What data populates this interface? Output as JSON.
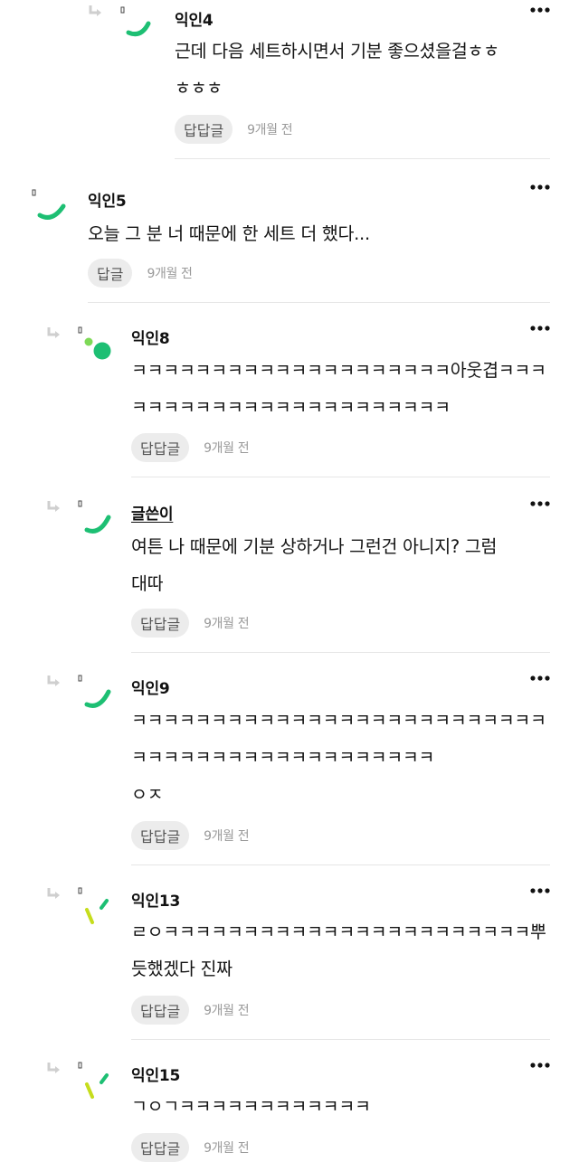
{
  "comments": [
    {
      "author": "익인4",
      "lines": [
        "근데 다음 세트하시면서 기분 좋으셨을걸ㅎㅎ",
        "ㅎㅎㅎ"
      ],
      "reply_label": "답답글",
      "time": "9개월 전"
    },
    {
      "author": "익인5",
      "lines": [
        "오늘 그 분 너 때문에 한 세트 더 했다..."
      ],
      "reply_label": "답글",
      "time": "9개월 전"
    },
    {
      "author": "익인8",
      "lines": [
        "ㅋㅋㅋㅋㅋㅋㅋㅋㅋㅋㅋㅋㅋㅋㅋㅋㅋㅋㅋㅋ아웃겹ㅋㅋㅋ",
        "ㅋㅋㅋㅋㅋㅋㅋㅋㅋㅋㅋㅋㅋㅋㅋㅋㅋㅋㅋㅋ"
      ],
      "reply_label": "답답글",
      "time": "9개월 전"
    },
    {
      "author": "글쓴이",
      "lines": [
        "여튼 나 때문에 기분 상하거나 그런건 아니지? 그럼",
        "대따"
      ],
      "reply_label": "답답글",
      "time": "9개월 전"
    },
    {
      "author": "익인9",
      "lines": [
        "ㅋㅋㅋㅋㅋㅋㅋㅋㅋㅋㅋㅋㅋㅋㅋㅋㅋㅋㅋㅋㅋㅋㅋㅋㅋㅋ",
        "ㅋㅋㅋㅋㅋㅋㅋㅋㅋㅋㅋㅋㅋㅋㅋㅋㅋㅋㅋ",
        "ㅇㅈ"
      ],
      "reply_label": "답답글",
      "time": "9개월 전"
    },
    {
      "author": "익인13",
      "lines": [
        "ㄹㅇㅋㅋㅋㅋㅋㅋㅋㅋㅋㅋㅋㅋㅋㅋㅋㅋㅋㅋㅋㅋㅋㅋㅋ뿌",
        "듯했겠다 진짜"
      ],
      "reply_label": "답답글",
      "time": "9개월 전"
    },
    {
      "author": "익인15",
      "lines": [
        "ㄱㅇㄱㅋㅋㅋㅋㅋㅋㅋㅋㅋㅋㅋㅋ"
      ],
      "reply_label": "답답글",
      "time": "9개월 전"
    }
  ],
  "colors": {
    "avatar_green": "#1dbf73",
    "avatar_lime": "#c6dd1c",
    "avatar_dot_light": "#7ed957",
    "reply_button_bg": "#ececec",
    "divider": "#e6e6e6"
  },
  "icons": {
    "reply_arrow": "reply-arrow-icon",
    "more": "more-dots-icon"
  }
}
